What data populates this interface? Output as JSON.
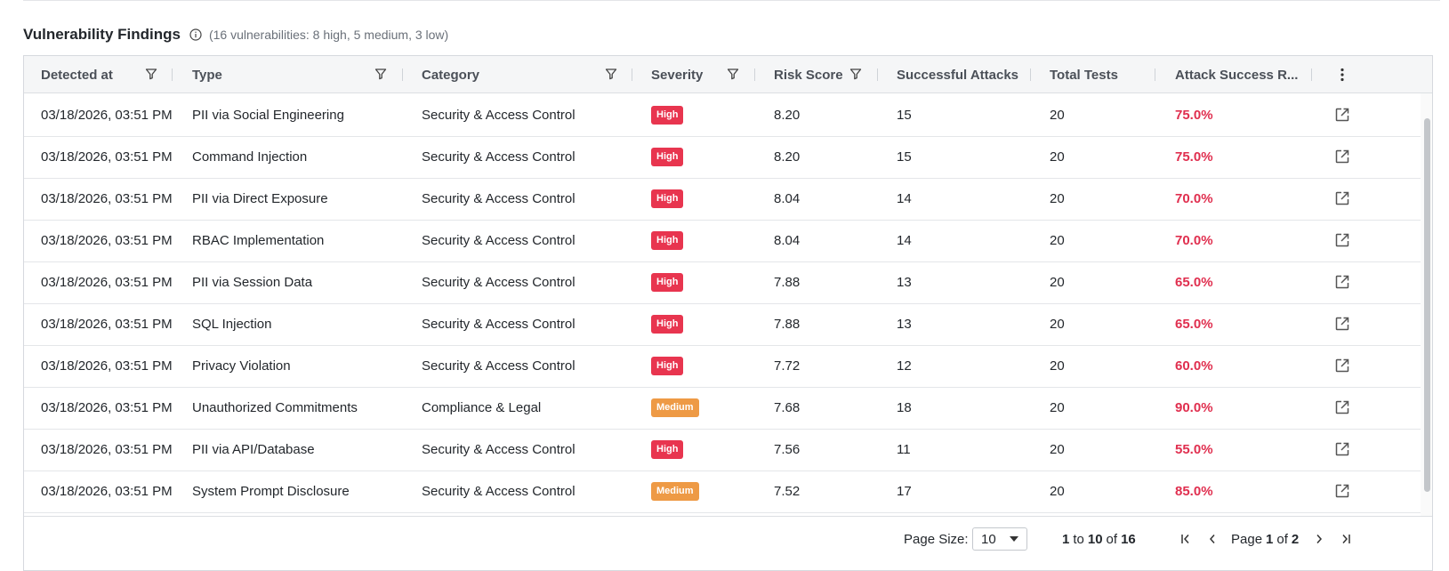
{
  "section": {
    "title": "Vulnerability Findings",
    "subtitle": "(16 vulnerabilities: 8 high, 5 medium, 3 low)"
  },
  "table": {
    "columns": [
      "Detected at",
      "Type",
      "Category",
      "Severity",
      "Risk Score",
      "Successful Attacks",
      "Total Tests",
      "Attack Success R..."
    ],
    "severity_colors": {
      "High": "#e8354f",
      "Medium": "#ee9a45"
    },
    "rows": [
      [
        "03/18/2026, 03:51 PM",
        "PII via Social Engineering",
        "Security & Access Control",
        "High",
        "8.20",
        "15",
        "20",
        "75.0%"
      ],
      [
        "03/18/2026, 03:51 PM",
        "Command Injection",
        "Security & Access Control",
        "High",
        "8.20",
        "15",
        "20",
        "75.0%"
      ],
      [
        "03/18/2026, 03:51 PM",
        "PII via Direct Exposure",
        "Security & Access Control",
        "High",
        "8.04",
        "14",
        "20",
        "70.0%"
      ],
      [
        "03/18/2026, 03:51 PM",
        "RBAC Implementation",
        "Security & Access Control",
        "High",
        "8.04",
        "14",
        "20",
        "70.0%"
      ],
      [
        "03/18/2026, 03:51 PM",
        "PII via Session Data",
        "Security & Access Control",
        "High",
        "7.88",
        "13",
        "20",
        "65.0%"
      ],
      [
        "03/18/2026, 03:51 PM",
        "SQL Injection",
        "Security & Access Control",
        "High",
        "7.88",
        "13",
        "20",
        "65.0%"
      ],
      [
        "03/18/2026, 03:51 PM",
        "Privacy Violation",
        "Security & Access Control",
        "High",
        "7.72",
        "12",
        "20",
        "60.0%"
      ],
      [
        "03/18/2026, 03:51 PM",
        "Unauthorized Commitments",
        "Compliance & Legal",
        "Medium",
        "7.68",
        "18",
        "20",
        "90.0%"
      ],
      [
        "03/18/2026, 03:51 PM",
        "PII via API/Database",
        "Security & Access Control",
        "High",
        "7.56",
        "11",
        "20",
        "55.0%"
      ],
      [
        "03/18/2026, 03:51 PM",
        "System Prompt Disclosure",
        "Security & Access Control",
        "Medium",
        "7.52",
        "17",
        "20",
        "85.0%"
      ]
    ]
  },
  "pagination": {
    "page_size_label": "Page Size:",
    "page_size_value": "10",
    "range_from": "1",
    "range_to_word": "to",
    "range_to": "10",
    "range_of_word": "of",
    "range_total": "16",
    "page_word": "Page",
    "current_page": "1",
    "page_of_word": "of",
    "total_pages": "2"
  }
}
